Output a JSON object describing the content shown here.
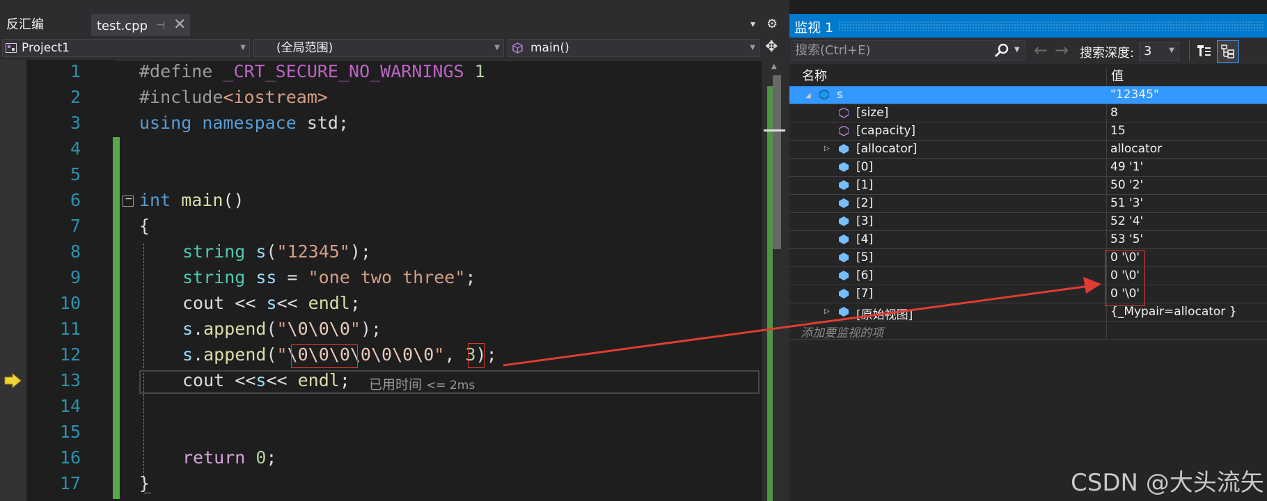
{
  "tabs": {
    "disasm_label": "反汇编",
    "active_label": "test.cpp",
    "pin_glyph": "⊣",
    "close_glyph": "✕",
    "dropdown_glyph": "▾",
    "gear_glyph": "⚙"
  },
  "navbar": {
    "project": "Project1",
    "scope": "(全局范围)",
    "function": "main()",
    "split_glyph": "✥"
  },
  "code": {
    "lines": [
      "1",
      "2",
      "3",
      "4",
      "5",
      "6",
      "7",
      "8",
      "9",
      "10",
      "11",
      "12",
      "13",
      "14",
      "15",
      "16",
      "17"
    ],
    "l1_define": "#define",
    "l1_macro": " _CRT_SECURE_NO_WARNINGS ",
    "l1_num": "1",
    "l2_include": "#include",
    "l2_header": "<iostream>",
    "l3_using": "using",
    "l3_namespace": " namespace",
    "l3_rest": " std;",
    "l6_collapse": "−",
    "l6_int": "int",
    "l6_main": " main",
    "l6_paren": "()",
    "l7": "{",
    "l8_type": "string",
    "l8_var": " s",
    "l8_p1": "(",
    "l8_str": "\"12345\"",
    "l8_p2": ");",
    "l9_type": "string",
    "l9_var": " ss",
    "l9_eq": " = ",
    "l9_str": "\"one two three\"",
    "l9_end": ";",
    "l10_cout": "cout",
    "l10_op1": " << ",
    "l10_s": "s",
    "l10_op2": "<< ",
    "l10_endl": "endl",
    "l10_end": ";",
    "l11_s": "s",
    "l11_dot": ".",
    "l11_fn": "append",
    "l11_p1": "(",
    "l11_q1": "\"",
    "l11_esc": "\\0\\0\\0",
    "l11_q2": "\"",
    "l11_p2": ");",
    "l12_s": "s",
    "l12_dot": ".",
    "l12_fn": "append",
    "l12_p1": "(",
    "l12_q1": "\"",
    "l12_esc1": "\\0\\0\\0",
    "l12_esc2": "\\0\\0\\0\\0",
    "l12_q2": "\"",
    "l12_comma": ", ",
    "l12_num": "3",
    "l12_p2": ");",
    "l13_cout": "cout",
    "l13_op1": " <<",
    "l13_s": "s",
    "l13_op2": "<< ",
    "l13_endl": "endl",
    "l13_end": ";",
    "l13_perf": "已用时间",
    "l13_perf_val": "<= 2ms",
    "l16_return": "return",
    "l16_num": " 0",
    "l16_end": ";",
    "l17": "}",
    "arrow_glyph": "⇨"
  },
  "watch": {
    "title": "监视 1",
    "search_placeholder": "搜索(Ctrl+E)",
    "depth_label": "搜索深度:",
    "depth_value": "3",
    "col_name": "名称",
    "col_value": "值",
    "rows": [
      {
        "name": "s",
        "value": "\"12345\""
      },
      {
        "name": "[size]",
        "value": "8"
      },
      {
        "name": "[capacity]",
        "value": "15"
      },
      {
        "name": "[allocator]",
        "value": "allocator"
      },
      {
        "name": "[0]",
        "value": "49 '1'"
      },
      {
        "name": "[1]",
        "value": "50 '2'"
      },
      {
        "name": "[2]",
        "value": "51 '3'"
      },
      {
        "name": "[3]",
        "value": "52 '4'"
      },
      {
        "name": "[4]",
        "value": "53 '5'"
      },
      {
        "name": "[5]",
        "value": "0 '\\0'"
      },
      {
        "name": "[6]",
        "value": "0 '\\0'"
      },
      {
        "name": "[7]",
        "value": "0 '\\0'"
      },
      {
        "name": "[原始视图]",
        "value": "{_Mypair=allocator }"
      }
    ],
    "add_item": "添加要监视的项"
  },
  "watermark": "CSDN @大头流矢",
  "colors": {
    "accent": "#007acc",
    "annotation_red": "#e03c31",
    "change_bar": "#57a64a"
  }
}
